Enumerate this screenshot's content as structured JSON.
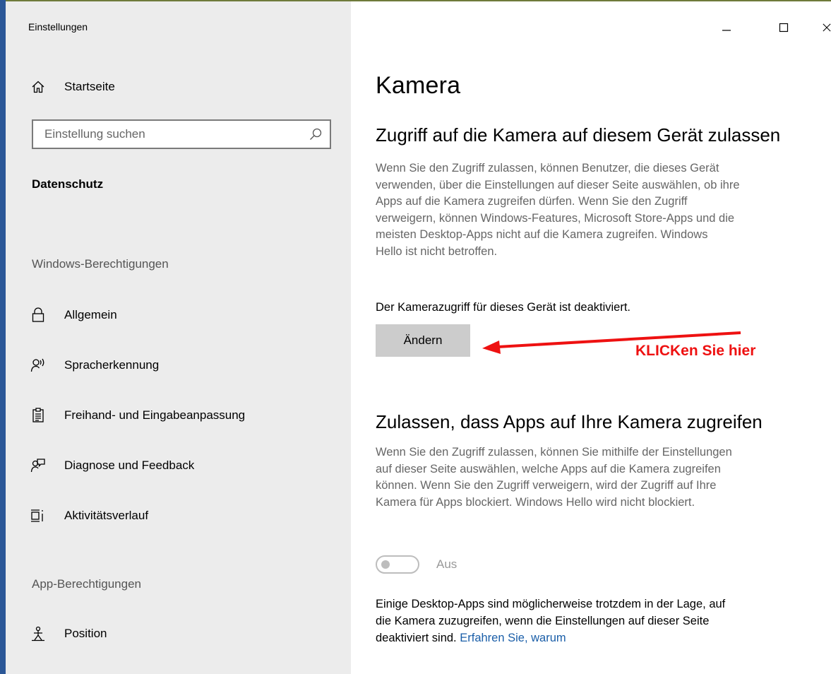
{
  "window": {
    "title": "Einstellungen",
    "controls": [
      "minimize-icon",
      "maximize-icon",
      "close-icon"
    ]
  },
  "sidebar": {
    "home_label": "Startseite",
    "search_placeholder": "Einstellung suchen",
    "current_section": "Datenschutz",
    "group1_header": "Windows-Berechtigungen",
    "group1_items": [
      {
        "label": "Allgemein",
        "icon": "lock-icon"
      },
      {
        "label": "Spracherkennung",
        "icon": "speech-icon"
      },
      {
        "label": "Freihand- und Eingabeanpassung",
        "icon": "clipboard-icon"
      },
      {
        "label": "Diagnose und Feedback",
        "icon": "feedback-icon"
      },
      {
        "label": "Aktivitätsverlauf",
        "icon": "timeline-icon"
      }
    ],
    "group2_header": "App-Berechtigungen",
    "group2_items": [
      {
        "label": "Position",
        "icon": "location-person-icon"
      }
    ]
  },
  "main": {
    "title": "Kamera",
    "section1": {
      "heading": "Zugriff auf die Kamera auf diesem Gerät zulassen",
      "description_lines": [
        "Wenn Sie den Zugriff zulassen, können Benutzer, die dieses Gerät",
        "verwenden, über die Einstellungen auf dieser Seite auswählen, ob ihre",
        "Apps auf die Kamera zugreifen dürfen. Wenn Sie den Zugriff",
        "verweigern, können Windows-Features, Microsoft Store-Apps und die",
        "meisten Desktop-Apps nicht auf die Kamera zugreifen. Windows",
        "Hello ist nicht betroffen."
      ],
      "status": "Der Kamerazugriff für dieses Gerät ist deaktiviert.",
      "button_label": "Ändern"
    },
    "section2": {
      "heading": "Zulassen, dass Apps auf Ihre Kamera zugreifen",
      "description_lines": [
        "Wenn Sie den Zugriff zulassen, können Sie mithilfe der Einstellungen",
        "auf dieser Seite auswählen, welche Apps auf die Kamera zugreifen",
        "können. Wenn Sie den Zugriff verweigern, wird der Zugriff auf Ihre",
        "Kamera für Apps blockiert. Windows Hello wird nicht blockiert."
      ],
      "toggle_label": "Aus",
      "toggle_on": false,
      "note_lines": [
        "Einige Desktop-Apps sind möglicherweise trotzdem in der Lage, auf",
        "die Kamera zuzugreifen, wenn die Einstellungen auf dieser Seite",
        "deaktiviert sind."
      ],
      "note_link": "Erfahren Sie, warum"
    }
  },
  "annotation": {
    "text": "KLICKen Sie hier",
    "color": "#ee1111"
  }
}
